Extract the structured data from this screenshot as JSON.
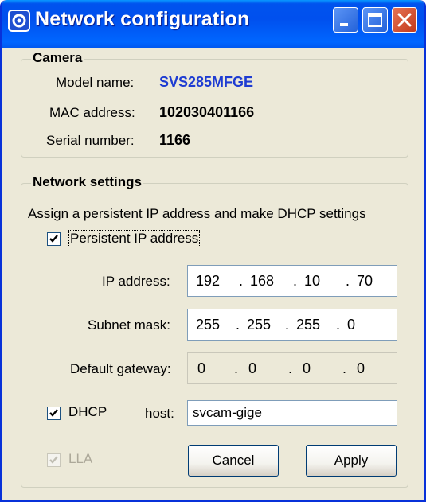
{
  "window": {
    "title": "Network configuration"
  },
  "camera": {
    "group_label": "Camera",
    "model_label": "Model name:",
    "model_value": "SVS285MFGE",
    "model_color": "#1E3CD2",
    "mac_label": "MAC address:",
    "mac_value": "102030401166",
    "serial_label": "Serial number:",
    "serial_value": "1166"
  },
  "network": {
    "group_label": "Network settings",
    "description": "Assign a persistent IP address and make DHCP settings",
    "persistent_label": "Persistent IP address",
    "persistent_checked": true,
    "ip_label": "IP address:",
    "ip": [
      "192",
      "168",
      "10",
      "70"
    ],
    "subnet_label": "Subnet mask:",
    "subnet": [
      "255",
      "255",
      "255",
      "0"
    ],
    "gateway_label": "Default gateway:",
    "gateway": [
      "0",
      "0",
      "0",
      "0"
    ],
    "dhcp_label": "DHCP",
    "dhcp_checked": true,
    "host_label": "host:",
    "host_value": "svcam-gige",
    "lla_label": "LLA",
    "lla_checked": true,
    "lla_disabled": true
  },
  "buttons": {
    "cancel": "Cancel",
    "apply": "Apply"
  },
  "icons": {
    "app": "network-camera-icon",
    "minimize": "minimize-icon",
    "maximize": "maximize-icon",
    "close": "close-icon",
    "checkmark": "checkmark-icon"
  }
}
